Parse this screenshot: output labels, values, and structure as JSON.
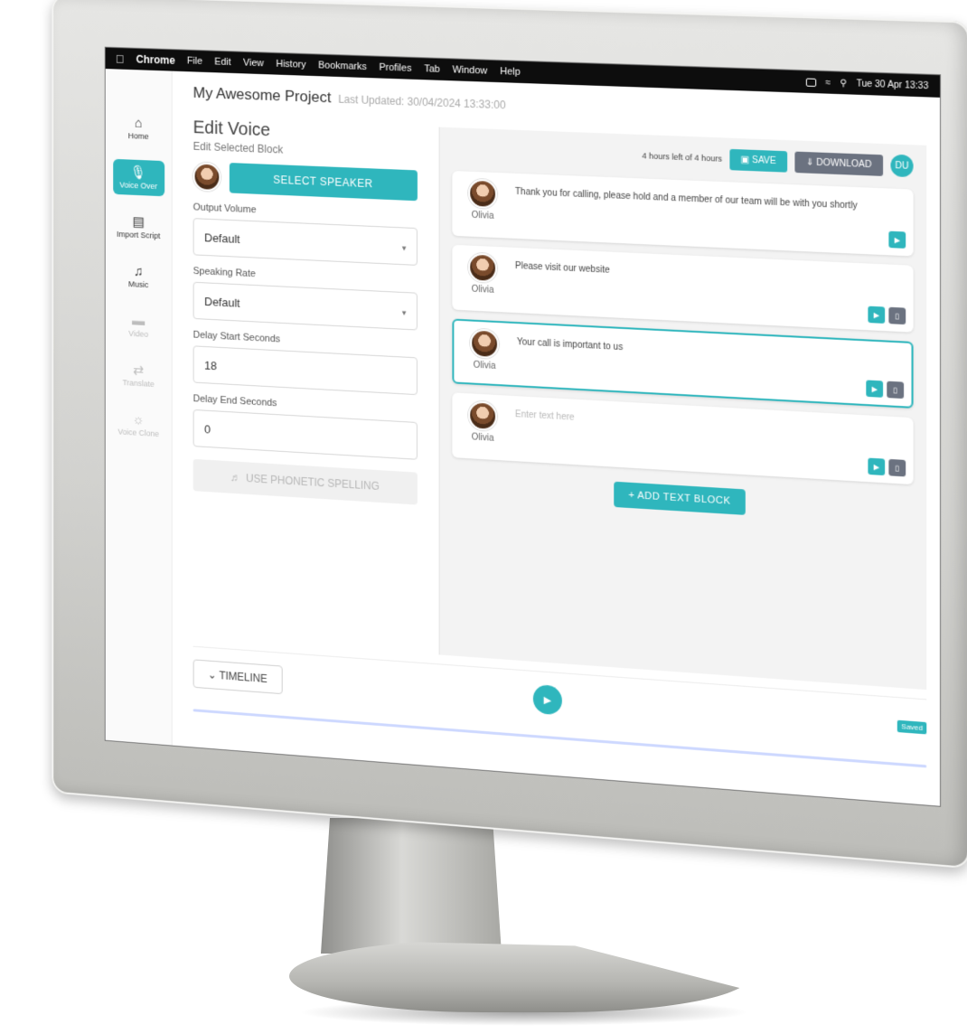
{
  "menubar": {
    "app": "Chrome",
    "menus": [
      "File",
      "Edit",
      "View",
      "History",
      "Bookmarks",
      "Profiles",
      "Tab",
      "Window",
      "Help"
    ],
    "clock": "Tue 30 Apr 13:33"
  },
  "sidebar": {
    "items": [
      {
        "label": "Home",
        "icon": "home-icon",
        "state": "normal"
      },
      {
        "label": "Voice Over",
        "icon": "microphone-icon",
        "state": "active"
      },
      {
        "label": "Import Script",
        "icon": "script-icon",
        "state": "normal"
      },
      {
        "label": "Music",
        "icon": "music-note-icon",
        "state": "normal"
      },
      {
        "label": "Video",
        "icon": "video-icon",
        "state": "disabled"
      },
      {
        "label": "Translate",
        "icon": "translate-icon",
        "state": "disabled"
      },
      {
        "label": "Voice Clone",
        "icon": "voice-clone-icon",
        "state": "disabled"
      }
    ]
  },
  "header": {
    "project_title": "My Awesome Project",
    "last_updated": "Last Updated: 30/04/2024 13:33:00"
  },
  "edit_panel": {
    "title": "Edit Voice",
    "subtitle": "Edit Selected Block",
    "select_speaker_label": "SELECT SPEAKER",
    "output_volume_label": "Output Volume",
    "output_volume_value": "Default",
    "speaking_rate_label": "Speaking Rate",
    "speaking_rate_value": "Default",
    "delay_start_label": "Delay Start Seconds",
    "delay_start_value": "18",
    "delay_end_label": "Delay End Seconds",
    "delay_end_value": "0",
    "phonetic_label": "USE PHONETIC SPELLING"
  },
  "toolbar": {
    "hours_left": "4 hours left of 4 hours",
    "save_label": "SAVE",
    "download_label": "DOWNLOAD",
    "user_initials": "DU"
  },
  "blocks": [
    {
      "speaker": "Olivia",
      "text": "Thank you for calling, please hold and a member of our team will be with you shortly",
      "placeholder": false,
      "selected": false
    },
    {
      "speaker": "Olivia",
      "text": "Please visit our website",
      "placeholder": false,
      "selected": false
    },
    {
      "speaker": "Olivia",
      "text": "Your call is important to us",
      "placeholder": false,
      "selected": true
    },
    {
      "speaker": "Olivia",
      "text": "Enter text here",
      "placeholder": true,
      "selected": false
    }
  ],
  "add_block_label": "+ ADD TEXT BLOCK",
  "timeline": {
    "toggle_label": "TIMELINE",
    "saved_label": "Saved"
  },
  "colors": {
    "accent": "#2fb6bd",
    "secondary": "#6b7280",
    "menubar": "#0d0d0d"
  }
}
